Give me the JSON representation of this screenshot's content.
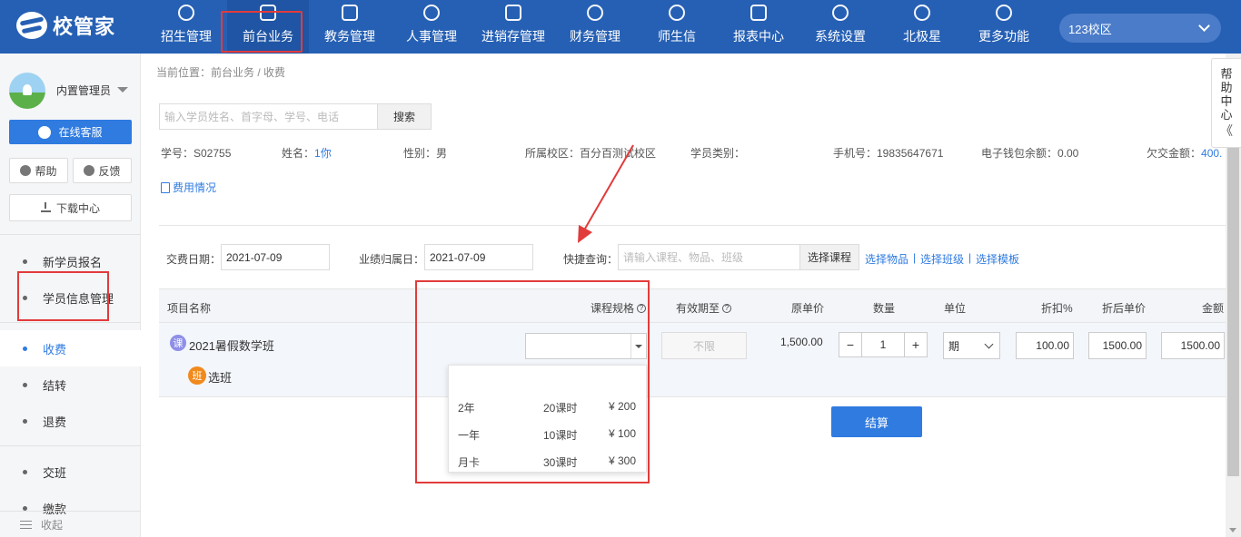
{
  "app": {
    "logo_text": "校管家",
    "campus": "123校区"
  },
  "nav": [
    {
      "label": "招生管理"
    },
    {
      "label": "前台业务"
    },
    {
      "label": "教务管理"
    },
    {
      "label": "人事管理"
    },
    {
      "label": "进销存管理"
    },
    {
      "label": "财务管理"
    },
    {
      "label": "师生信"
    },
    {
      "label": "报表中心"
    },
    {
      "label": "系统设置"
    },
    {
      "label": "北极星"
    },
    {
      "label": "更多功能"
    }
  ],
  "user": {
    "name": "内置管理员"
  },
  "sidebar": {
    "service_label": "在线客服",
    "help_label": "帮助",
    "feedback_label": "反馈",
    "download_label": "下载中心",
    "items": [
      {
        "label": "新学员报名"
      },
      {
        "label": "学员信息管理"
      },
      {
        "label": "收费"
      },
      {
        "label": "结转"
      },
      {
        "label": "退费"
      },
      {
        "label": "交班"
      },
      {
        "label": "缴款"
      }
    ],
    "collapse_label": "收起"
  },
  "breadcrumb": "当前位置：前台业务 / 收费",
  "search": {
    "placeholder": "输入学员姓名、首字母、学号、电话",
    "button": "搜索"
  },
  "student": {
    "id_text": "学号：S02755",
    "name_label": "姓名：",
    "name_value": "1你",
    "gender_text": "性别：男",
    "campus_text": "所属校区：百分百测试校区",
    "category_text": "学员类别：",
    "phone_text": "手机号：19835647671",
    "wallet_text": "电子钱包余额：0.00",
    "arrears_label": "欠交金额：",
    "arrears_value": "400."
  },
  "fee_link": "费用情况",
  "form": {
    "pay_date_label": "交费日期：",
    "pay_date": "2021-07-09",
    "perf_date_label": "业绩归属日：",
    "perf_date": "2021-07-09",
    "quick_label": "快捷查询：",
    "quick_placeholder": "请输入课程、物品、班级",
    "select_course": "选择课程",
    "select_goods": "选择物品",
    "select_class": "选择班级",
    "select_template": "选择模板"
  },
  "table": {
    "headers": {
      "name": "项目名称",
      "spec": "课程规格",
      "valid": "有效期至",
      "price": "原单价",
      "qty": "数量",
      "unit": "单位",
      "discount": "折扣%",
      "disc_price": "折后单价",
      "amount": "金额"
    },
    "row": {
      "course_badge": "课",
      "course_name": "2021暑假数学班",
      "class_badge": "班",
      "class_link": "选班",
      "valid": "不限",
      "price": "1,500.00",
      "qty": "1",
      "unit": "期",
      "discount": "100.00",
      "disc_price": "1500.00",
      "amount": "1500.00"
    }
  },
  "spec_options": [
    {
      "name": "2年",
      "hours": "20课时",
      "price": "¥ 200"
    },
    {
      "name": "一年",
      "hours": "10课时",
      "price": "¥ 100"
    },
    {
      "name": "月卡",
      "hours": "30课时",
      "price": "¥ 300"
    }
  ],
  "settle_button": "结算",
  "help_center": {
    "chars": [
      "帮",
      "助",
      "中",
      "心"
    ],
    "toggle": "《"
  },
  "colors": {
    "nav_bg": "#2660b4",
    "accent": "#2f7be0",
    "highlight": "#e23b3b"
  }
}
